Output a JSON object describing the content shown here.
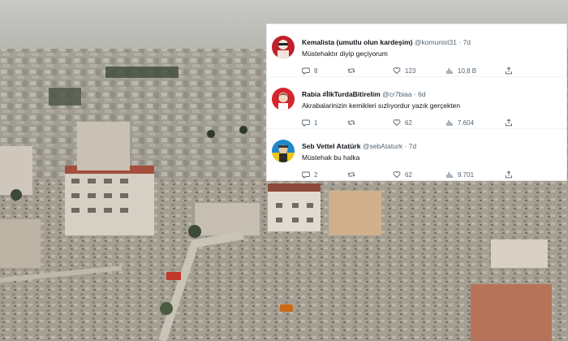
{
  "tweets": [
    {
      "name": "Kemalista (umutlu olun kardeşim)",
      "handle": "@komunist31",
      "time": "7d",
      "text": "Müstehaktır diyip geçiyorum",
      "replies": "8",
      "retweets": "",
      "likes": "123",
      "views": "10,8 B",
      "avatar_icon": "avatar-red-icon",
      "avatar_color": "#c0202a"
    },
    {
      "name": "Rabia #İlkTurdaBitirelim",
      "handle": "@cr7biaa",
      "time": "6d",
      "text": "Akrabalarinizin kemikleri sızlıyordur yazık gerçekten",
      "replies": "1",
      "retweets": "",
      "likes": "62",
      "views": "7.604",
      "avatar_icon": "avatar-red-portrait-icon",
      "avatar_color": "#d6252d"
    },
    {
      "name": "Seb Vettel Atatürk",
      "handle": "@sebAtaturk",
      "time": "7d",
      "text": "Müstehak bu halka",
      "replies": "2",
      "retweets": "",
      "likes": "62",
      "views": "9.701",
      "avatar_icon": "avatar-portrait-icon",
      "avatar_color": "#1e88c8"
    }
  ],
  "separator": "·",
  "colors": {
    "text": "#0f1419",
    "muted": "#536471",
    "background": "#ffffff"
  }
}
